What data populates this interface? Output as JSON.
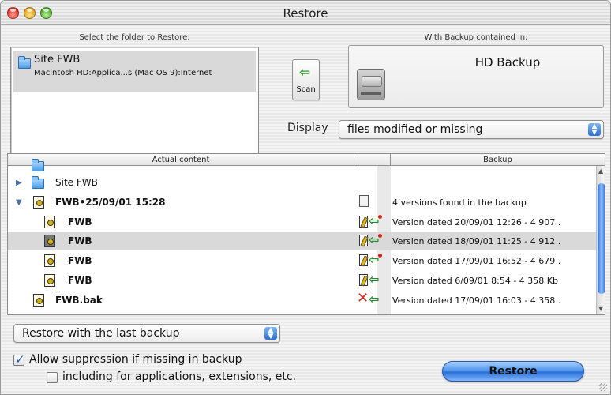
{
  "window": {
    "title": "Restore"
  },
  "source": {
    "label": "Select the folder to Restore:",
    "name": "Site FWB",
    "path": "Macintosh HD:Applica...s (Mac OS 9):Internet"
  },
  "scan": {
    "label": "Scan",
    "icon": "left-arrow-icon"
  },
  "backup": {
    "label": "With Backup contained in:",
    "name": "HD Backup",
    "icon": "hard-disk-icon"
  },
  "display": {
    "label": "Display",
    "selected": "files modified or missing"
  },
  "table": {
    "columns": [
      "Actual content",
      "",
      "Backup"
    ],
    "rows": [
      {
        "name": "Site FWB",
        "info": "",
        "expander": "collapsed",
        "icon": "folder-icon"
      },
      {
        "name": "FWB•25/09/01 15:28",
        "info": "4 versions found in the backup",
        "expander": "expanded",
        "icon": "file-icon"
      },
      {
        "name": "FWB",
        "info": "Version dated 20/09/01 12:26 - 4 907 .",
        "icon": "file-icon"
      },
      {
        "name": "FWB",
        "info": "Version dated 18/09/01 11:25 - 4 912 .",
        "icon": "file-icon",
        "selected": true
      },
      {
        "name": "FWB",
        "info": "Version dated 17/09/01 16:52 - 4 679 .",
        "icon": "file-icon"
      },
      {
        "name": "FWB",
        "info": "Version dated 6/09/01 8:54 - 4 358 Kb",
        "icon": "file-icon"
      },
      {
        "name": "FWB.bak",
        "info": "Version dated 17/09/01 16:03 - 4 358 .",
        "icon": "file-icon"
      }
    ]
  },
  "restore_mode": {
    "selected": "Restore with the last backup"
  },
  "options": {
    "allow_suppression": {
      "label": "Allow suppression if missing in backup",
      "checked": true
    },
    "including_apps": {
      "label": "including for applications, extensions, etc.",
      "checked": false
    }
  },
  "actions": {
    "restore_label": "Restore"
  },
  "colors": {
    "accent": "#2a6fd6",
    "green_arrow": "#1f8b2a",
    "red": "#d3261b"
  }
}
